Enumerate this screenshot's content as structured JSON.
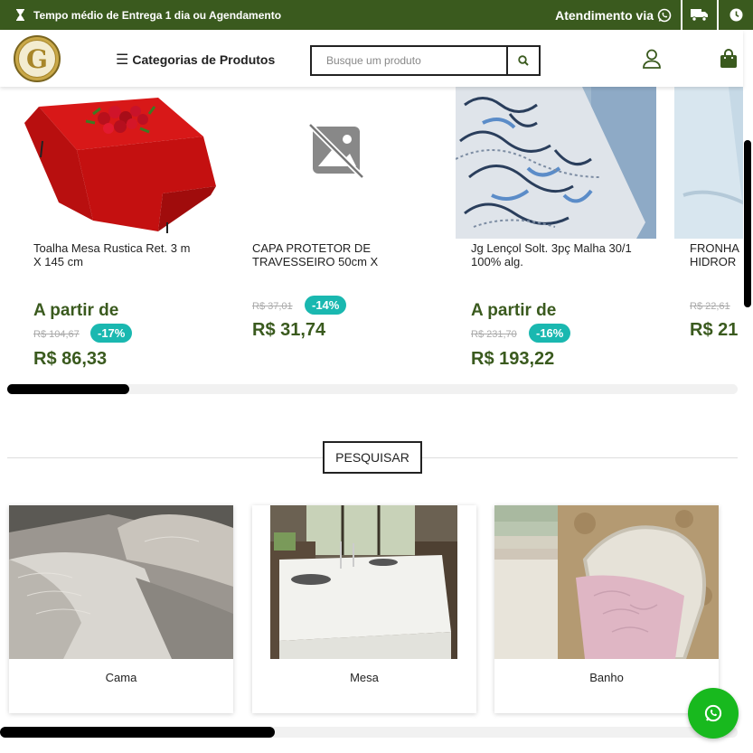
{
  "topbar": {
    "delivery_text": "Tempo médio de Entrega  1 dia ou Agendamento",
    "attendance_label": "Atendimento via",
    "bg_color": "#3a5a1e"
  },
  "header": {
    "logo_letter": "G",
    "categories_label": "Categorias de Produtos",
    "search_placeholder": "Busque um produto"
  },
  "products": [
    {
      "name": "Toalha Mesa Rustica Ret. 3 m X 145 cm",
      "from_label": "A partir de",
      "old_price": "R$ 104,67",
      "discount": "-17%",
      "price": "R$ 86,33"
    },
    {
      "name": "CAPA PROTETOR DE TRAVESSEIRO 50cm X",
      "old_price": "R$ 37,01",
      "discount": "-14%",
      "price": "R$ 31,74"
    },
    {
      "name": "Jg Lençol Solt. 3pç Malha 30/1 100% alg.",
      "from_label": "A partir de",
      "old_price": "R$ 231,70",
      "discount": "-16%",
      "price": "R$ 193,22"
    },
    {
      "name": "FRONHA HIDROR",
      "old_price": "R$ 22,61",
      "price": "R$ 21"
    }
  ],
  "pesquisar_label": "PESQUISAR",
  "categories": [
    {
      "label": "Cama"
    },
    {
      "label": "Mesa"
    },
    {
      "label": "Banho"
    }
  ],
  "colors": {
    "brand_green": "#3a5a1e",
    "discount_teal": "#1ab8b0",
    "whatsapp_green": "#18b91e"
  }
}
